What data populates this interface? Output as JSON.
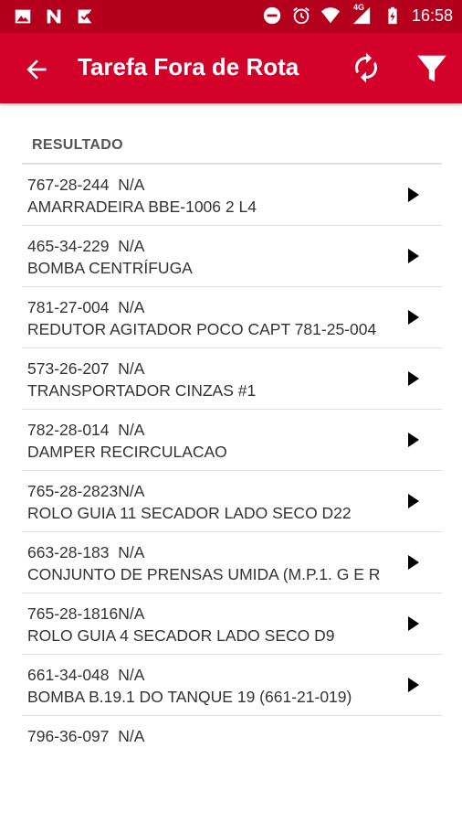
{
  "status_bar": {
    "time": "16:58",
    "network": "4G"
  },
  "header": {
    "title": "Tarefa Fora de Rota"
  },
  "section_title": "RESULTADO",
  "items": [
    {
      "code": "767-28-244  N/A",
      "description": "AMARRADEIRA BBE-1006 2 L4"
    },
    {
      "code": "465-34-229  N/A",
      "description": "BOMBA CENTRÍFUGA"
    },
    {
      "code": "781-27-004  N/A",
      "description": "REDUTOR AGITADOR POCO CAPT 781-25-004"
    },
    {
      "code": "573-26-207  N/A",
      "description": "TRANSPORTADOR CINZAS #1"
    },
    {
      "code": "782-28-014  N/A",
      "description": "DAMPER RECIRCULACAO"
    },
    {
      "code": "765-28-2823N/A",
      "description": "ROLO GUIA 11 SECADOR LADO SECO D22"
    },
    {
      "code": "663-28-183  N/A",
      "description": "CONJUNTO DE PRENSAS UMIDA (M.P.1. G E R"
    },
    {
      "code": "765-28-1816N/A",
      "description": "ROLO GUIA 4 SECADOR LADO SECO D9"
    },
    {
      "code": "661-34-048  N/A",
      "description": "BOMBA B.19.1 DO TANQUE 19 (661-21-019)"
    },
    {
      "code": "796-36-097  N/A",
      "description": ""
    }
  ]
}
